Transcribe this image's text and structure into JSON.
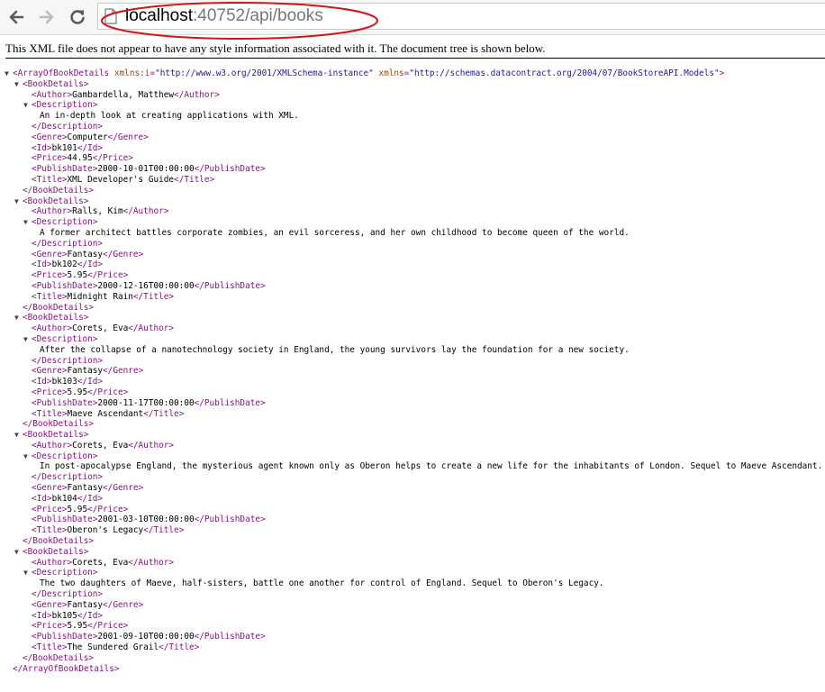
{
  "browser": {
    "url_host": "localhost",
    "url_rest": ":40752/api/books"
  },
  "notice": "This XML file does not appear to have any style information associated with it. The document tree is shown below.",
  "root": {
    "open_tag": "<ArrayOfBookDetails",
    "attr1_name": "xmlns:i",
    "attr1_value": "\"http://www.w3.org/2001/XMLSchema-instance\"",
    "attr2_name": "xmlns",
    "attr2_value": "\"http://schemas.datacontract.org/2004/07/BookStoreAPI.Models\"",
    "close_tag": "</ArrayOfBookDetails>"
  },
  "books": [
    {
      "author": "Gambardella, Matthew",
      "description": "An in-depth look at creating applications with XML.",
      "genre": "Computer",
      "id": "bk101",
      "price": "44.95",
      "publish_date": "2000-10-01T00:00:00",
      "title": "XML Developer's Guide"
    },
    {
      "author": "Ralls, Kim",
      "description": "A former architect battles corporate zombies, an evil sorceress, and her own childhood to become queen of the world.",
      "genre": "Fantasy",
      "id": "bk102",
      "price": "5.95",
      "publish_date": "2000-12-16T00:00:00",
      "title": "Midnight Rain"
    },
    {
      "author": "Corets, Eva",
      "description": "After the collapse of a nanotechnology society in England, the young survivors lay the foundation for a new society.",
      "genre": "Fantasy",
      "id": "bk103",
      "price": "5.95",
      "publish_date": "2000-11-17T00:00:00",
      "title": "Maeve Ascendant"
    },
    {
      "author": "Corets, Eva",
      "description": "In post-apocalypse England, the mysterious agent known only as Oberon helps to create a new life for the inhabitants of London. Sequel to Maeve Ascendant.",
      "genre": "Fantasy",
      "id": "bk104",
      "price": "5.95",
      "publish_date": "2001-03-10T00:00:00",
      "title": "Oberon's Legacy"
    },
    {
      "author": "Corets, Eva",
      "description": "The two daughters of Maeve, half-sisters, battle one another for control of England. Sequel to Oberon's Legacy.",
      "genre": "Fantasy",
      "id": "bk105",
      "price": "5.95",
      "publish_date": "2001-09-10T00:00:00",
      "title": "The Sundered Grail"
    }
  ],
  "tags": {
    "book": "BookDetails",
    "author": "Author",
    "description": "Description",
    "genre": "Genre",
    "id": "Id",
    "price": "Price",
    "publish_date": "PublishDate",
    "title": "Title"
  },
  "colors": {
    "tag": "#881280",
    "attribute": "#994500",
    "attribute_value": "#1a1aa6",
    "annotation": "#d0161a"
  }
}
